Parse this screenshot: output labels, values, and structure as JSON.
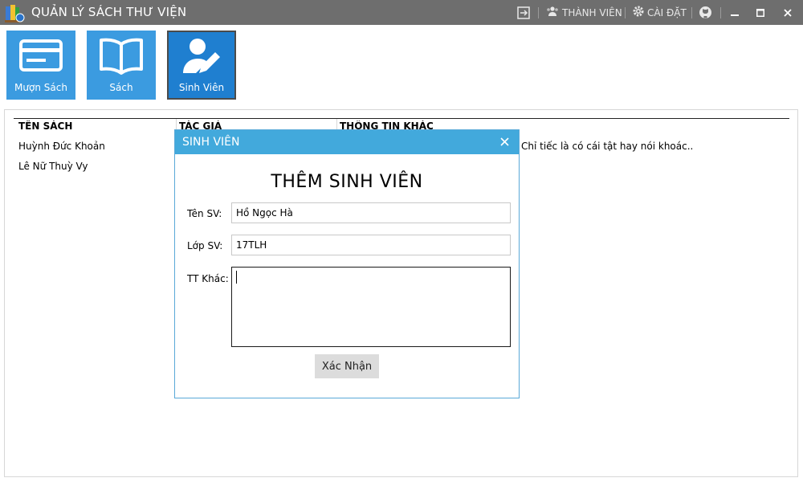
{
  "window": {
    "title": "QUẢN LÝ SÁCH THƯ VIỆN",
    "members_label": "THÀNH VIÊN",
    "settings_label": "CÀI ĐẶT"
  },
  "toolbar": {
    "tiles": [
      {
        "label": "Mượn Sách",
        "icon": "card-icon"
      },
      {
        "label": "Sách",
        "icon": "open-book-icon"
      },
      {
        "label": "Sinh Viên",
        "icon": "student-edit-icon",
        "active": true
      }
    ]
  },
  "table": {
    "columns": [
      "TÊN SÁCH",
      "TÁC GIẢ",
      "THÔNG TIN KHÁC"
    ],
    "rows": [
      {
        "name": "Huỳnh Đức Khoản",
        "info": "Chỉ tiếc là có cái tật hay nói khoác.."
      },
      {
        "name": "Lê Nữ Thuỳ Vy",
        "info": ""
      }
    ]
  },
  "dialog": {
    "title": "SINH VIÊN",
    "heading": "THÊM SINH VIÊN",
    "name_label": "Tên SV:",
    "name_value": "Hồ Ngọc Hà",
    "class_label": "Lớp SV:",
    "class_value": "17TLH",
    "other_label": "TT Khác:",
    "other_value": "",
    "confirm_label": "Xác Nhận"
  },
  "colors": {
    "titlebar": "#6e6e6e",
    "tile": "#3b9be0",
    "tile_active": "#1f7fd0",
    "dialog_titlebar": "#42a9dc"
  }
}
